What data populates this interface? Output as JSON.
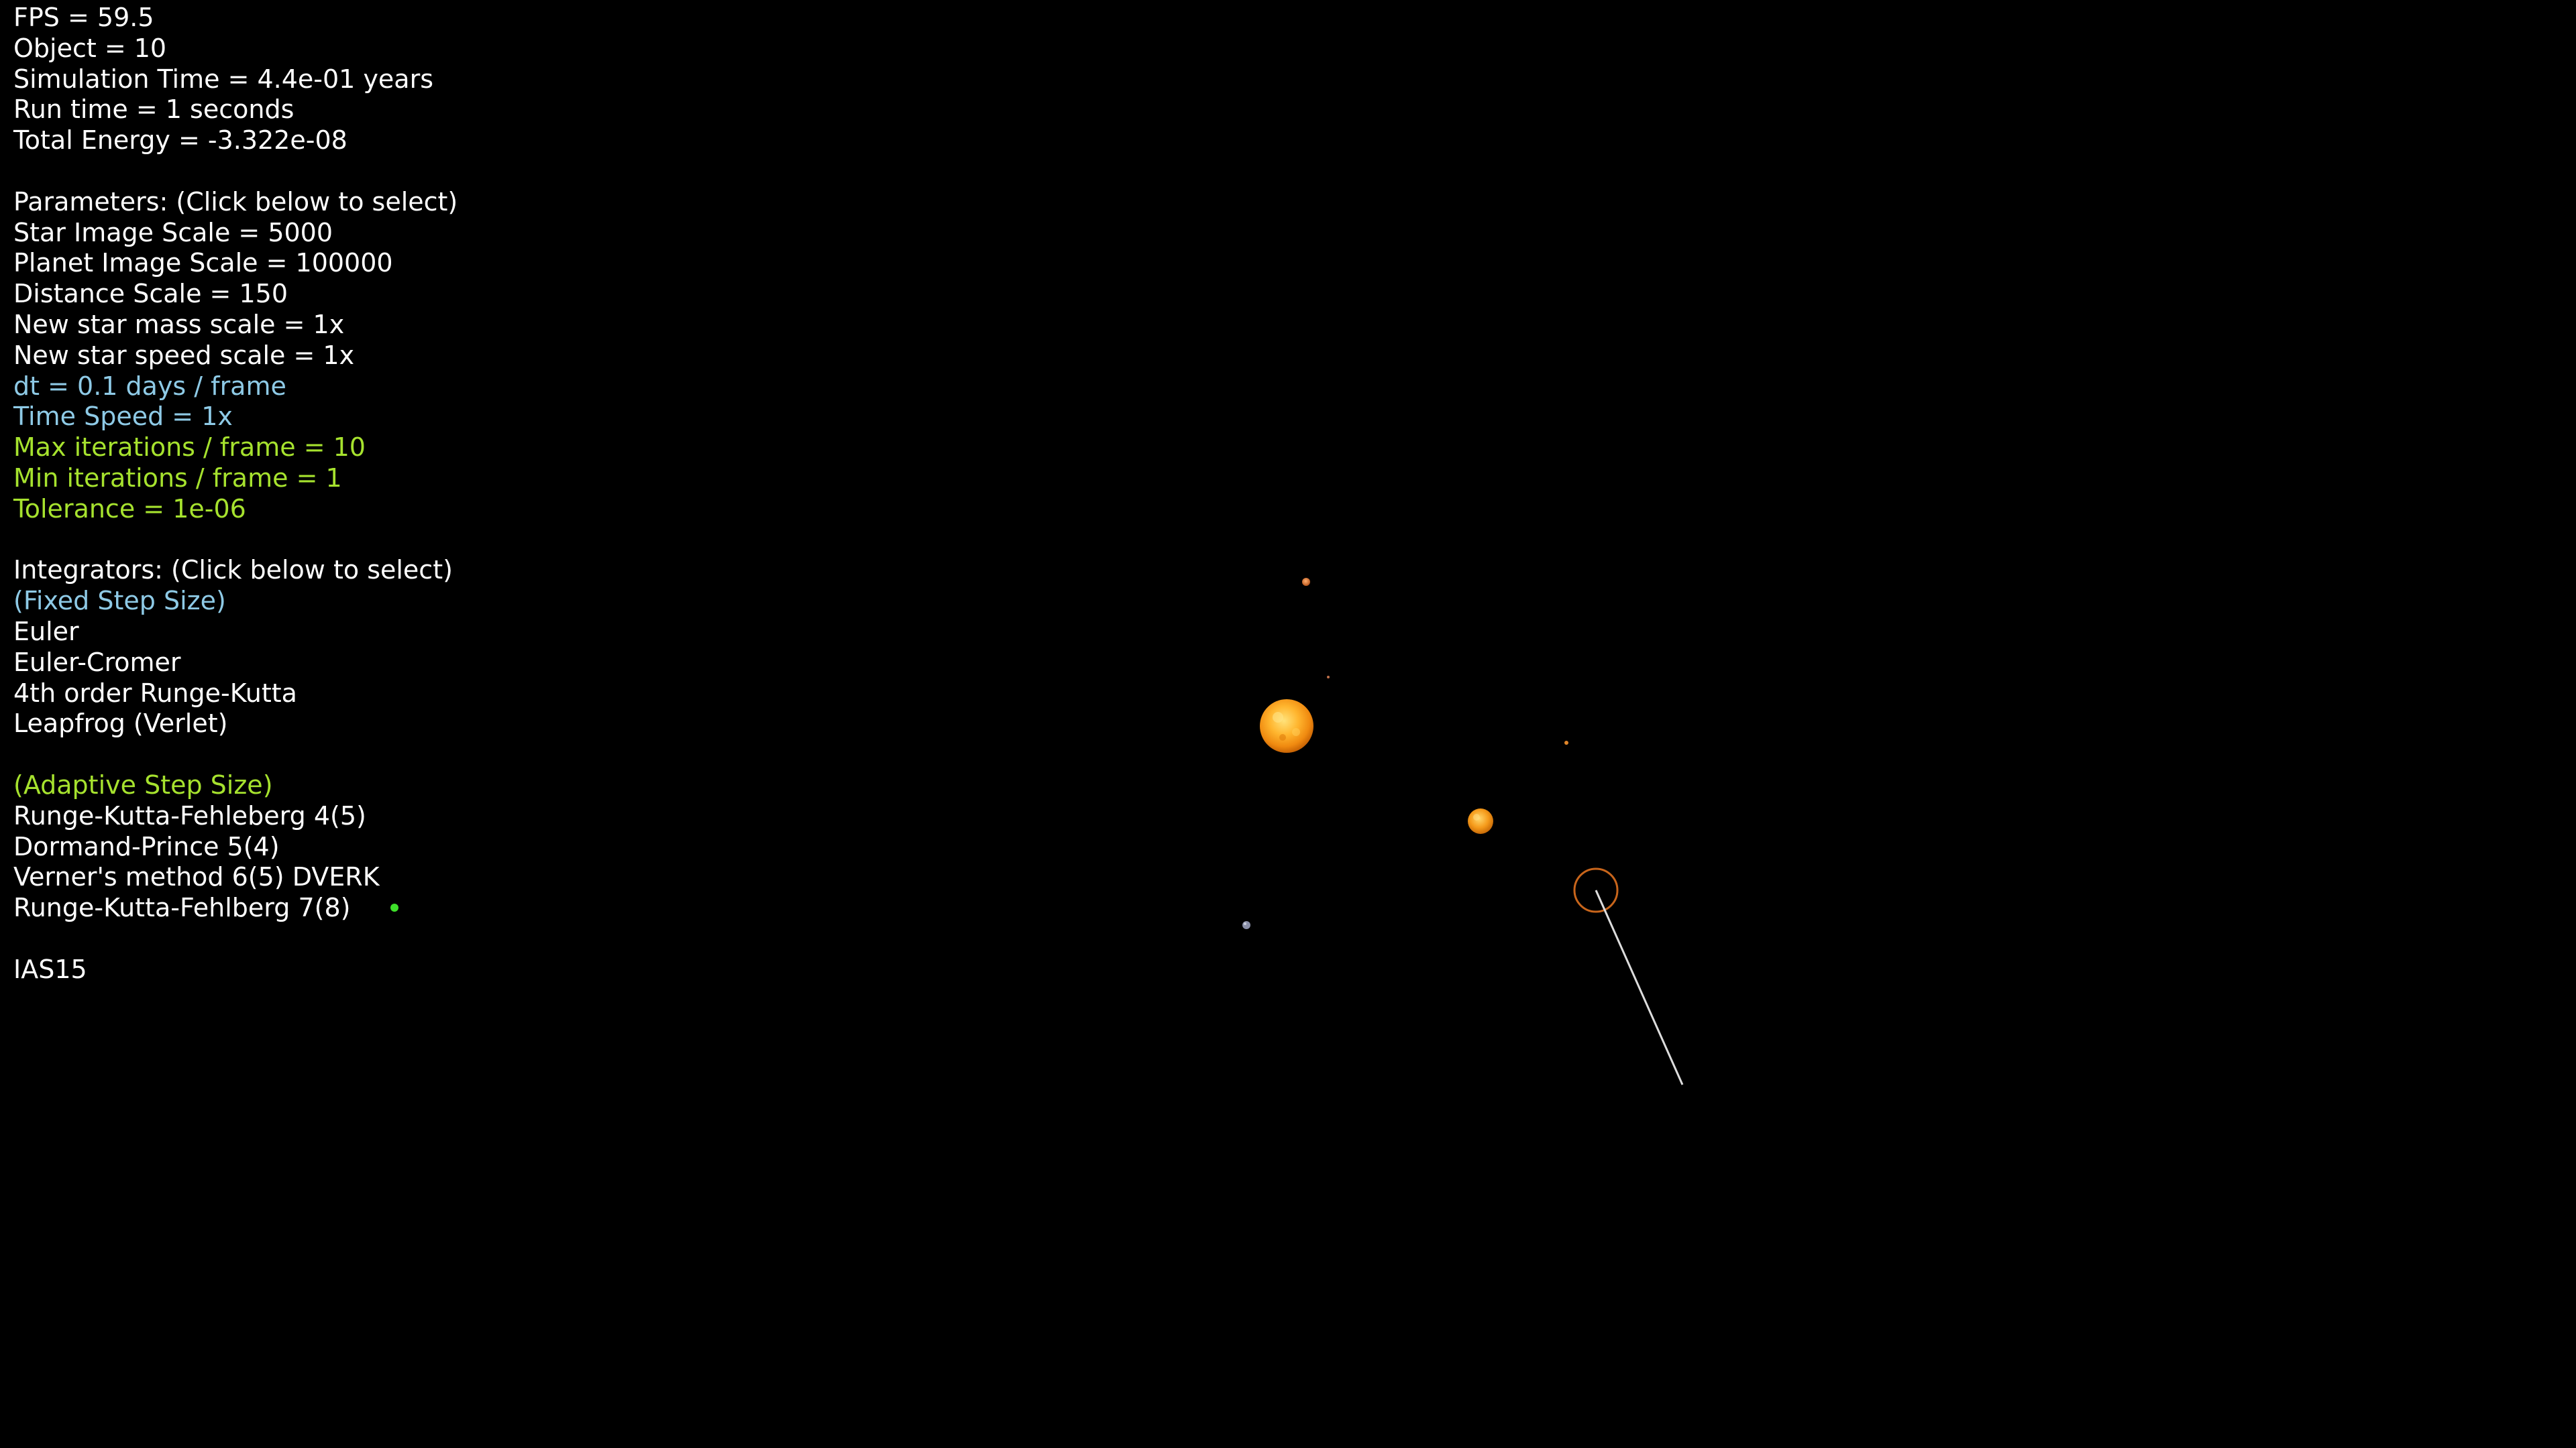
{
  "stats": {
    "fps": "FPS = 59.5",
    "objects": "Object = 10",
    "sim_time": "Simulation Time = 4.4e-01 years",
    "run_time": "Run time = 1 seconds",
    "total_energy": "Total Energy = -3.322e-08"
  },
  "parameters": {
    "header": "Parameters: (Click below to select)",
    "items": [
      {
        "label": "Star Image Scale = 5000",
        "tone": "white"
      },
      {
        "label": "Planet Image Scale = 100000",
        "tone": "white"
      },
      {
        "label": "Distance Scale = 150",
        "tone": "white"
      },
      {
        "label": "New star mass scale = 1x",
        "tone": "white"
      },
      {
        "label": "New star speed scale = 1x",
        "tone": "white"
      },
      {
        "label": "dt = 0.1 days / frame",
        "tone": "blue"
      },
      {
        "label": "Time Speed = 1x",
        "tone": "blue"
      },
      {
        "label": "Max iterations / frame = 10",
        "tone": "green"
      },
      {
        "label": "Min iterations / frame = 1",
        "tone": "green"
      },
      {
        "label": "Tolerance = 1e-06",
        "tone": "green"
      }
    ]
  },
  "integrators": {
    "header": "Integrators: (Click below to select)",
    "fixed_header": "(Fixed Step Size)",
    "fixed": [
      "Euler",
      "Euler-Cromer",
      "4th order Runge-Kutta",
      "Leapfrog (Verlet)"
    ],
    "adaptive_header": "(Adaptive Step Size)",
    "adaptive": [
      "Runge-Kutta-Fehleberg 4(5)",
      "Dormand-Prince 5(4)",
      "Verner's method 6(5) DVERK",
      "Runge-Kutta-Fehlberg 7(8)"
    ],
    "other": [
      "IAS15"
    ],
    "selected": "Runge-Kutta-Fehlberg 7(8)"
  },
  "colors": {
    "background": "#000000",
    "text": "#ffffff",
    "fixed_accent": "#8ecae6",
    "adaptive_accent": "#a6e22e",
    "selected_marker": "#3ee02a",
    "star": "#f5a623",
    "cursor_ring": "#c8651b",
    "drag_line": "#dddddd"
  },
  "scene_icons": [
    "star-icon",
    "planet-icon",
    "new-star-cursor-icon"
  ]
}
